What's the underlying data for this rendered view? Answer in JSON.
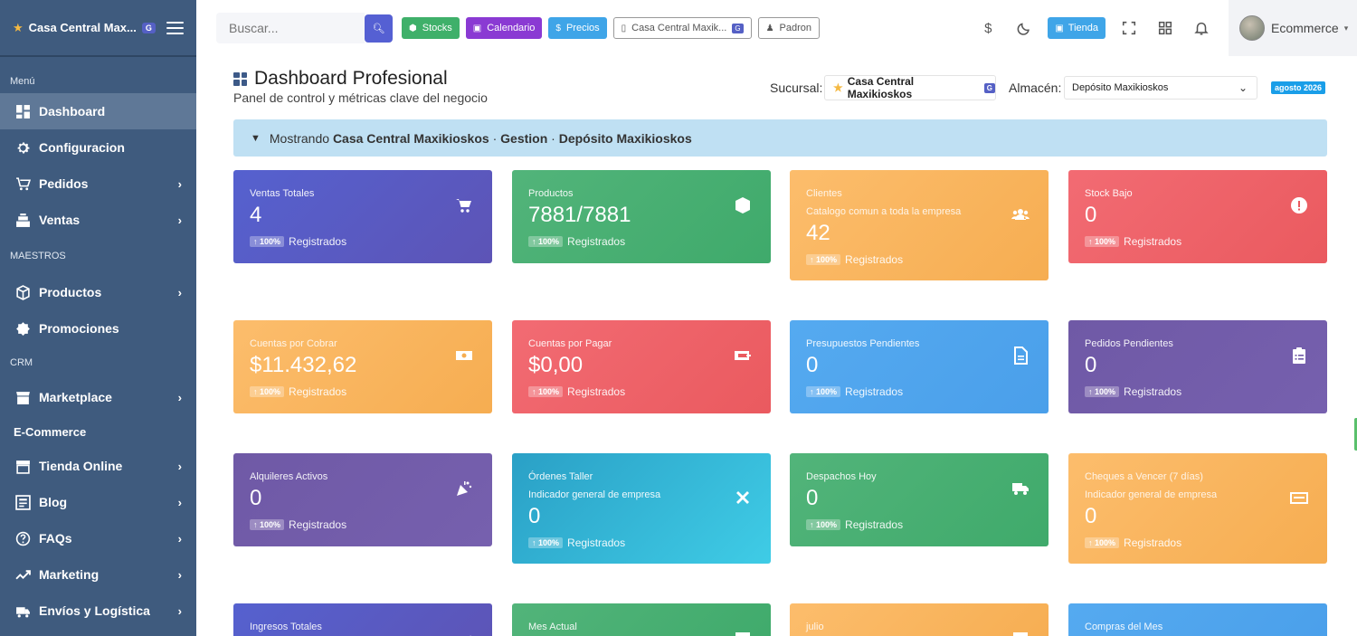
{
  "sidebar": {
    "brand": "Casa Central Max...",
    "brand_badge": "G",
    "sections": {
      "menu": "Menú",
      "maestros": "MAESTROS",
      "crm": "CRM",
      "ecommerce": "E-Commerce"
    },
    "items": [
      {
        "label": "Dashboard",
        "icon": "dashboard-icon",
        "active": true
      },
      {
        "label": "Configuracion",
        "icon": "gear-icon"
      },
      {
        "label": "Pedidos",
        "icon": "cart-icon"
      },
      {
        "label": "Ventas",
        "icon": "register-icon"
      },
      {
        "label": "Productos",
        "icon": "box-icon"
      },
      {
        "label": "Promociones",
        "icon": "badge-icon"
      },
      {
        "label": "Marketplace",
        "icon": "store-icon"
      },
      {
        "label": "Tienda Online",
        "icon": "shop-icon"
      },
      {
        "label": "Blog",
        "icon": "blog-icon"
      },
      {
        "label": "FAQs",
        "icon": "question-icon"
      },
      {
        "label": "Marketing",
        "icon": "chart-icon"
      },
      {
        "label": "Envíos y Logística",
        "icon": "truck-icon"
      }
    ]
  },
  "topbar": {
    "search_placeholder": "Buscar...",
    "buttons": {
      "stocks": "Stocks",
      "calendario": "Calendario",
      "precios": "Precios",
      "branch": "Casa Central Maxik...",
      "branch_badge": "G",
      "padron": "Padron",
      "tienda": "Tienda"
    },
    "currency_symbol": "$",
    "user_name": "Ecommerce"
  },
  "header": {
    "title": "Dashboard Profesional",
    "subtitle": "Panel de control y métricas clave del negocio",
    "sucursal_label": "Sucursal:",
    "sucursal_value": "Casa Central Maxikioskos",
    "sucursal_badge": "G",
    "almacen_label": "Almacén:",
    "almacen_value": "Depósito Maxikioskos",
    "date_badge": "agosto 2026"
  },
  "info_bar": {
    "prefix": "Mostrando",
    "branch": "Casa Central Maxikioskos",
    "sep1": "·",
    "mode": "Gestion",
    "sep2": "·",
    "warehouse": "Depósito Maxikioskos"
  },
  "cards": [
    {
      "label": "Ventas Totales",
      "value": "4",
      "pct": "100%",
      "foot": "Registrados",
      "icon": "cart-icon",
      "color": "#5561cf"
    },
    {
      "label": "Productos",
      "value": "7881/7881",
      "pct": "100%",
      "foot": "Registrados",
      "icon": "cube-icon",
      "color": "#52b47a"
    },
    {
      "label": "Clientes",
      "sub": "Catalogo comun a toda la empresa",
      "value": "42",
      "pct": "100%",
      "foot": "Registrados",
      "icon": "users-icon",
      "color": "#fcbd6c"
    },
    {
      "label": "Stock Bajo",
      "value": "0",
      "pct": "100%",
      "foot": "Registrados",
      "icon": "alert-icon",
      "color": "#f26b73"
    },
    {
      "label": "Cuentas por Cobrar",
      "value": "$11.432,62",
      "pct": "100%",
      "foot": "Registrados",
      "icon": "money-icon",
      "color": "#fcbd6c"
    },
    {
      "label": "Cuentas por Pagar",
      "value": "$0,00",
      "pct": "100%",
      "foot": "Registrados",
      "icon": "payment-icon",
      "color": "#f26b73"
    },
    {
      "label": "Presupuestos Pendientes",
      "value": "0",
      "pct": "100%",
      "foot": "Registrados",
      "icon": "document-icon",
      "color": "#55aaf0"
    },
    {
      "label": "Pedidos Pendientes",
      "value": "0",
      "pct": "100%",
      "foot": "Registrados",
      "icon": "clipboard-icon",
      "color": "#6f59a6"
    },
    {
      "label": "Alquileres Activos",
      "value": "0",
      "pct": "100%",
      "foot": "Registrados",
      "icon": "party-icon",
      "color": "#6f59a6"
    },
    {
      "label": "Órdenes Taller",
      "sub": "Indicador general de empresa",
      "value": "0",
      "pct": "100%",
      "foot": "Registrados",
      "icon": "tools-icon",
      "color": "#2aa0c6"
    },
    {
      "label": "Despachos Hoy",
      "value": "0",
      "pct": "100%",
      "foot": "Registrados",
      "icon": "truck-icon",
      "color": "#52b47a"
    },
    {
      "label": "Cheques a Vencer (7 días)",
      "sub": "Indicador general de empresa",
      "value": "0",
      "pct": "100%",
      "foot": "Registrados",
      "icon": "check-icon",
      "color": "#fcbd6c"
    },
    {
      "label": "Ingresos Totales",
      "icon": "trend-icon",
      "color": "#5561cf"
    },
    {
      "label": "Mes Actual",
      "icon": "calendar-icon",
      "color": "#52b47a"
    },
    {
      "label": "julio",
      "icon": "calendar-icon",
      "color": "#fcbd6c"
    },
    {
      "label": "Compras del Mes",
      "icon": "basket-icon",
      "color": "#55aaf0"
    }
  ]
}
